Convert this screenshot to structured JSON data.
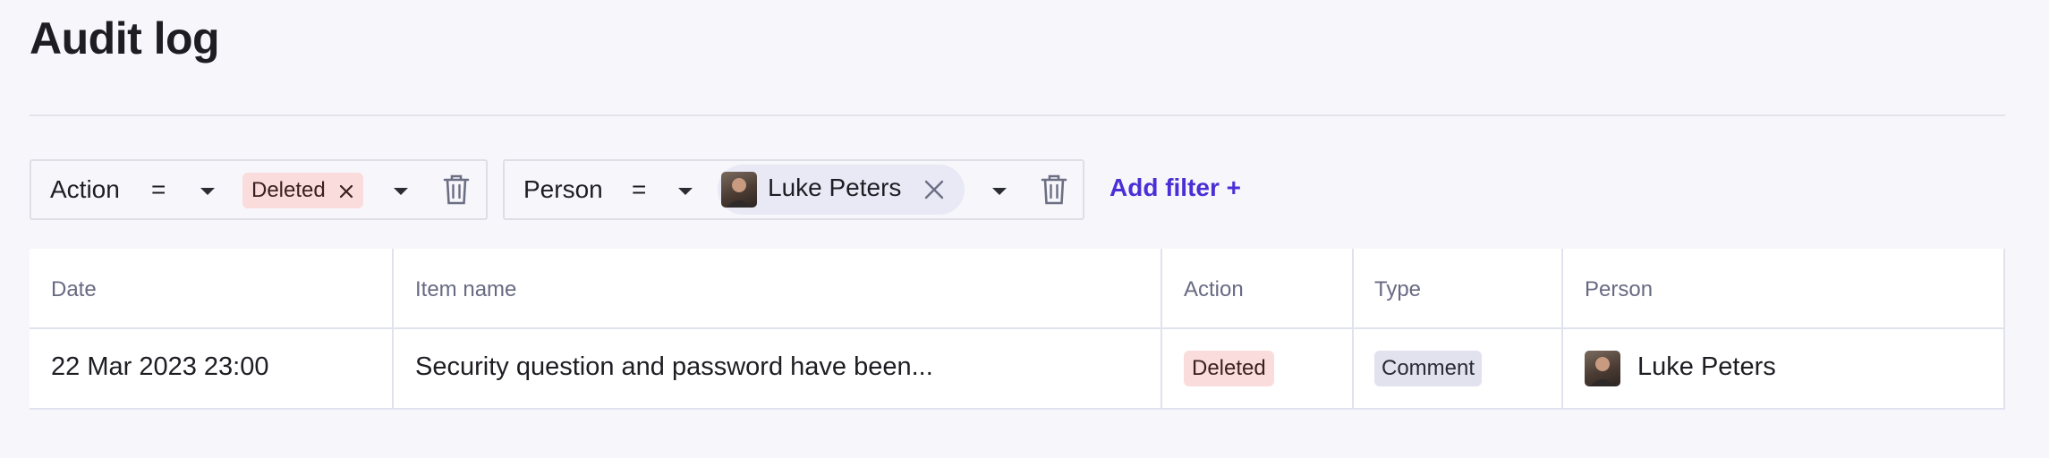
{
  "page": {
    "title": "Audit log"
  },
  "filters": [
    {
      "label": "Action",
      "operator": "=",
      "value": "Deleted"
    },
    {
      "label": "Person",
      "operator": "=",
      "value": "Luke Peters"
    }
  ],
  "add_filter_label": "Add filter +",
  "table": {
    "columns": [
      "Date",
      "Item name",
      "Action",
      "Type",
      "Person"
    ],
    "rows": [
      {
        "date": "22 Mar 2023 23:00",
        "item_name": "Security question and password have been...",
        "action": "Deleted",
        "type": "Comment",
        "person": "Luke Peters"
      }
    ]
  },
  "colors": {
    "accent": "#4b2fd6",
    "deleted_badge": "#fbdcdc",
    "comment_badge": "#e1e2ee",
    "person_chip": "#e8e9f5"
  },
  "icons": [
    "chevron-down-icon",
    "close-icon",
    "trash-icon",
    "avatar"
  ]
}
